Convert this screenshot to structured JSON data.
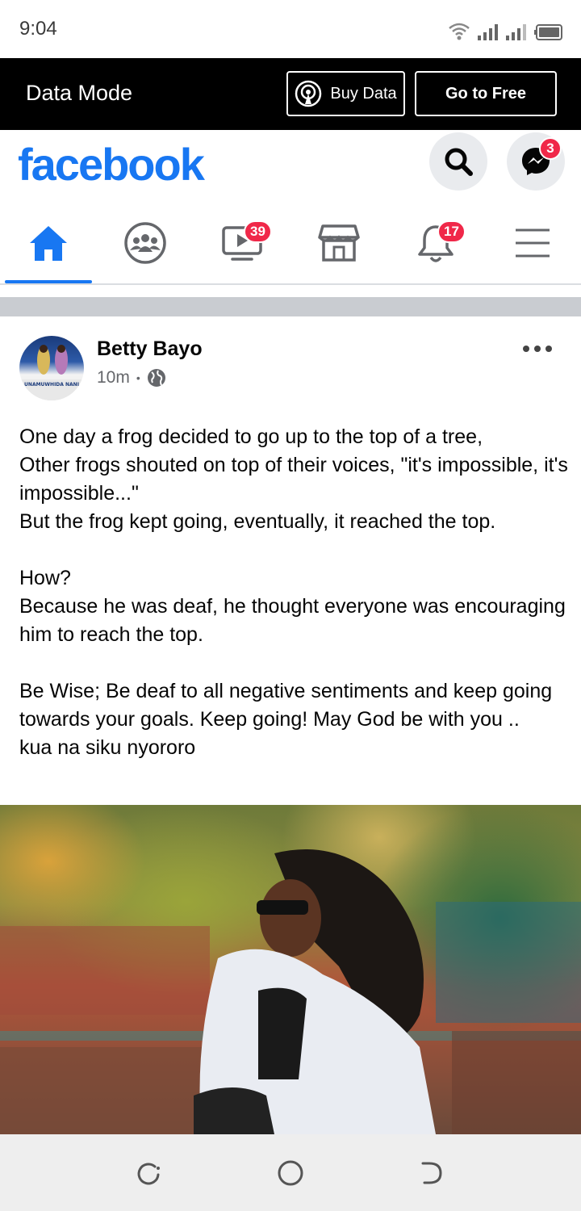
{
  "status_bar": {
    "time": "9:04"
  },
  "data_banner": {
    "mode_label": "Data Mode",
    "buy_data_label": "Buy Data",
    "go_free_label": "Go to Free"
  },
  "header": {
    "logo_text": "facebook",
    "messenger_badge": "3",
    "brand_color": "#1877f2"
  },
  "nav_tabs": [
    {
      "name": "home",
      "icon": "home-icon",
      "active": true,
      "badge": ""
    },
    {
      "name": "groups",
      "icon": "groups-icon",
      "active": false,
      "badge": ""
    },
    {
      "name": "watch",
      "icon": "watch-video-icon",
      "active": false,
      "badge": "39"
    },
    {
      "name": "marketplace",
      "icon": "marketplace-store-icon",
      "active": false,
      "badge": ""
    },
    {
      "name": "notifications",
      "icon": "bell-icon",
      "active": false,
      "badge": "17"
    },
    {
      "name": "menu",
      "icon": "hamburger-menu-icon",
      "active": false,
      "badge": ""
    }
  ],
  "post": {
    "author": "Betty Bayo",
    "time": "10m",
    "bullet": "•",
    "audience_icon": "globe-icon",
    "avatar_caption": "UNAMUWHIDA NANI",
    "paragraphs": [
      "One day a frog decided to go up to the top of a tree,\nOther frogs shouted on top of their voices, \"it's impossible, it's impossible...\"\nBut the frog kept going, eventually, it reached the top.",
      "How?\nBecause he was deaf, he thought everyone was encouraging him to reach the top.",
      "Be Wise; Be deaf to all negative sentiments and keep going towards your goals. Keep going! May God be with you ..\nkua na siku nyororo"
    ]
  }
}
